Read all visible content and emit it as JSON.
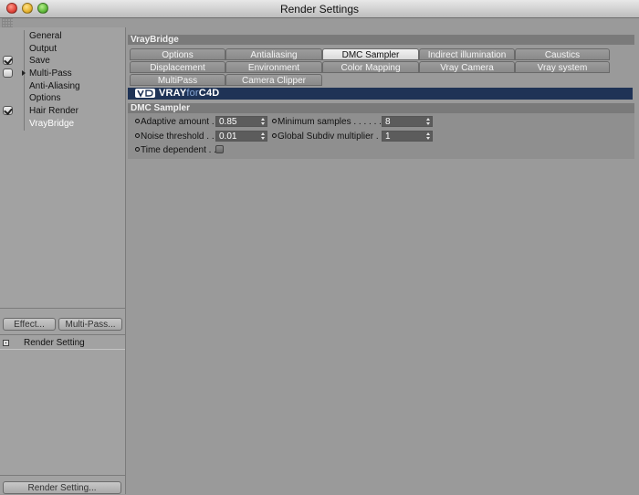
{
  "window": {
    "title": "Render Settings"
  },
  "sidebar": {
    "items": [
      {
        "label": "General",
        "checkbox": null,
        "expander": false,
        "selected": false
      },
      {
        "label": "Output",
        "checkbox": null,
        "expander": false,
        "selected": false
      },
      {
        "label": "Save",
        "checkbox": true,
        "expander": false,
        "selected": false
      },
      {
        "label": "Multi-Pass",
        "checkbox": false,
        "expander": true,
        "selected": false
      },
      {
        "label": "Anti-Aliasing",
        "checkbox": null,
        "expander": false,
        "selected": false
      },
      {
        "label": "Options",
        "checkbox": null,
        "expander": false,
        "selected": false
      },
      {
        "label": "Hair Render",
        "checkbox": true,
        "expander": false,
        "selected": false
      },
      {
        "label": "VrayBridge",
        "checkbox": null,
        "expander": false,
        "selected": true
      }
    ],
    "effect_button": "Effect...",
    "multipass_button": "Multi-Pass...",
    "render_setting_item": "Render Setting",
    "render_setting_button": "Render Setting..."
  },
  "main": {
    "header": "VrayBridge",
    "tabs_row1": [
      "Options",
      "Antialiasing",
      "DMC Sampler",
      "Indirect illumination (GI)",
      "Caustics"
    ],
    "tabs_row2": [
      "Displacement",
      "Environment",
      "Color Mapping",
      "Vray Camera",
      "Vray system"
    ],
    "tabs_row3": [
      "MultiPass",
      "Camera Clipper"
    ],
    "active_tab": "DMC Sampler",
    "banner": {
      "vray": "VRAY",
      "for": "for",
      "c4d": "C4D"
    },
    "section": "DMC Sampler",
    "params": {
      "adaptive_amount": {
        "label": "Adaptive amount . .",
        "value": "0.85"
      },
      "noise_threshold": {
        "label": "Noise threshold . .",
        "value": "0.01"
      },
      "time_dependent": {
        "label": "Time dependent . .",
        "checked": false
      },
      "minimum_samples": {
        "label": "Minimum samples . . . . . . .",
        "value": "8"
      },
      "global_subdiv": {
        "label": "Global Subdiv multiplier . .",
        "value": "1"
      }
    }
  },
  "colors": {
    "banner": "#1f3356",
    "panel": "#9a9a9a",
    "header": "#7a7a7a"
  }
}
